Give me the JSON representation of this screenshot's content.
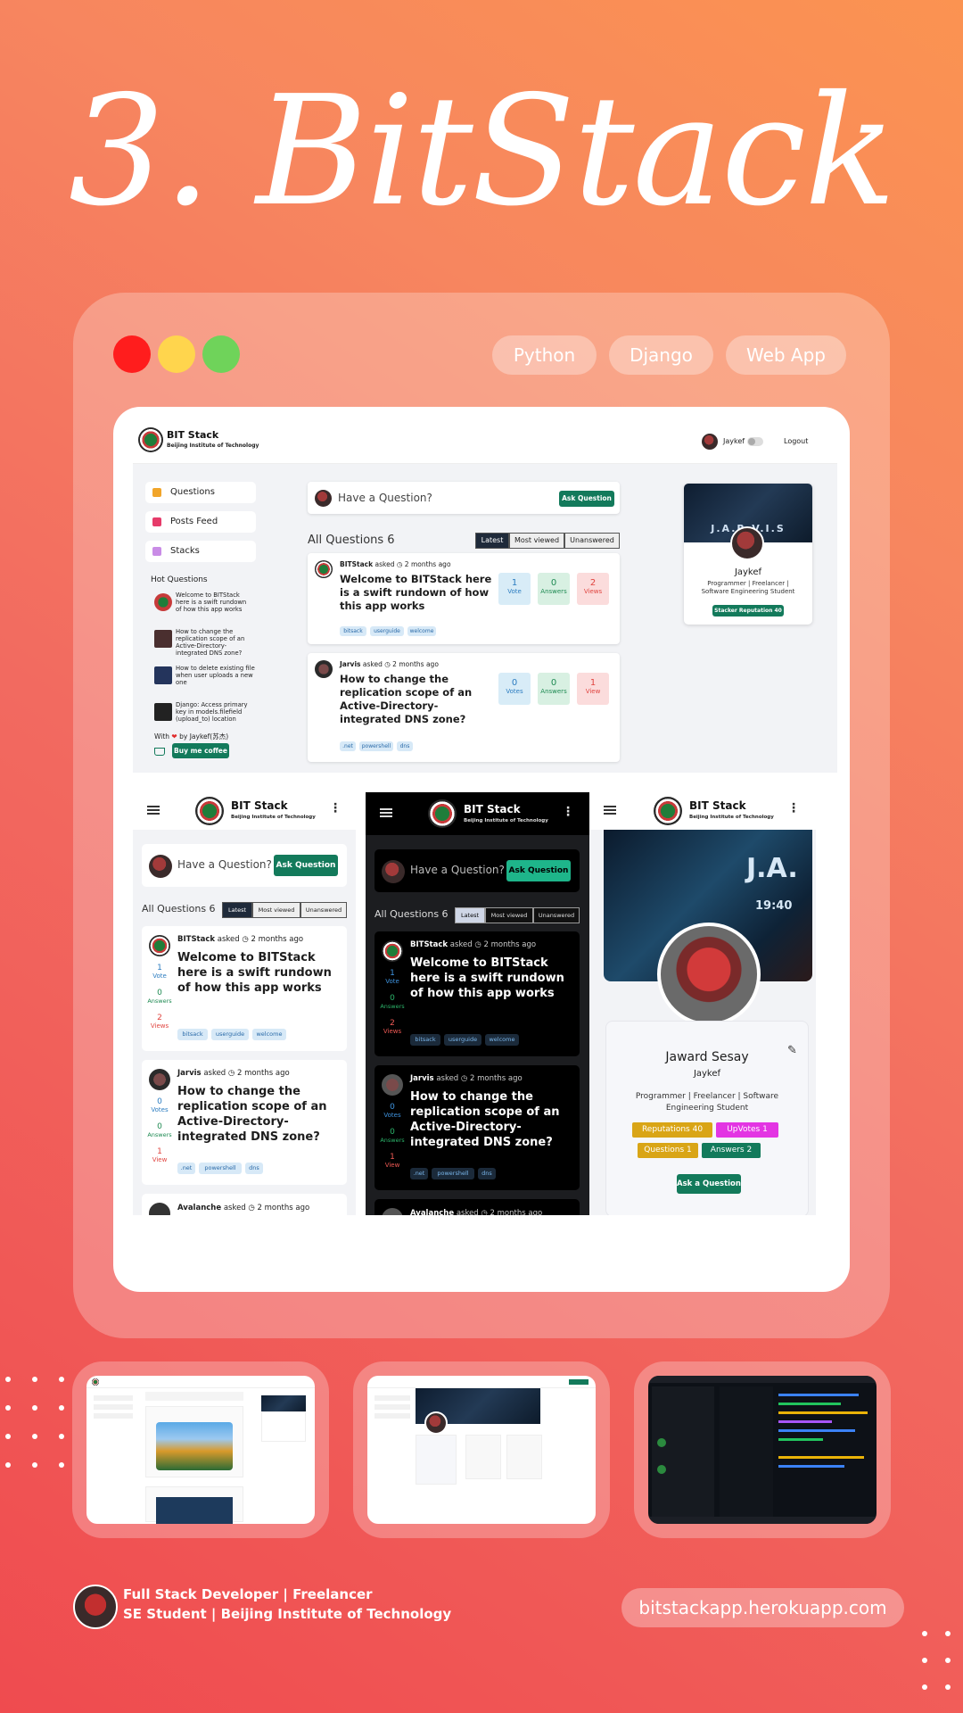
{
  "title": "3. BitStack",
  "window": {
    "dot_colors": [
      "#ff1d1d",
      "#ffd54d",
      "#6fd35a"
    ],
    "tags": [
      "Python",
      "Django",
      "Web App"
    ]
  },
  "brand": {
    "name": "BIT Stack",
    "sub": "Beijing Institute of Technology"
  },
  "desktop": {
    "user": "Jaykef",
    "logout": "Logout",
    "nav": [
      "Questions",
      "Posts Feed",
      "Stacks"
    ],
    "hot_title": "Hot Questions",
    "hot": [
      "Welcome to BITStack here is a swift rundown of how this app works",
      "How to change the replication scope of an Active-Directory-integrated DNS zone?",
      "How to delete existing file when user uploads a new one",
      "Django: Access primary key in models.filefield (upload_to) location"
    ],
    "with_prefix": "With",
    "with_heart": "❤",
    "with_by": "by Jaykef(苏杰)",
    "coffee": "Buy me coffee",
    "ask_placeholder": "Have a Question?",
    "ask_btn": "Ask Question",
    "all_q": "All Questions 6",
    "tabs": [
      "Latest",
      "Most viewed",
      "Unanswered"
    ],
    "questions": [
      {
        "author": "BITStack",
        "asked": "asked",
        "time": "2 months ago",
        "title": "Welcome to BITStack here is a swift rundown of how this app works",
        "tags": [
          "bitsack",
          "userguide",
          "welcome"
        ],
        "votes": "1",
        "votes_label": "Vote",
        "answers": "0",
        "answers_label": "Answers",
        "views": "2",
        "views_label": "Views"
      },
      {
        "author": "Jarvis",
        "asked": "asked",
        "time": "2 months ago",
        "title": "How to change the replication scope of an Active-Directory-integrated DNS zone?",
        "tags": [
          ".net",
          "powershell",
          "dns"
        ],
        "votes": "0",
        "votes_label": "Votes",
        "answers": "0",
        "answers_label": "Answers",
        "views": "1",
        "views_label": "View"
      }
    ],
    "profile": {
      "banner": "J.A.R.V.I.S",
      "name": "Jaykef",
      "bio": "Programmer | Freelancer | Software Engineering Student",
      "rep": "Stacker Reputation 40"
    }
  },
  "mobile": {
    "third_author": "Avalanche",
    "profile": {
      "banner": "J.A.",
      "clock": "19:40",
      "full_name": "Jaward Sesay",
      "username": "Jaykef",
      "bio": "Programmer | Freelancer | Software Engineering Student",
      "badges": [
        "Reputations 40",
        "UpVotes 1",
        "Questions 1",
        "Answers 2"
      ],
      "ask": "Ask a Question"
    }
  },
  "footer": {
    "line1": "Full Stack Developer | Freelancer",
    "line2": "SE Student | Beijing Institute of Technology",
    "url": "bitstackapp.herokuapp.com"
  }
}
